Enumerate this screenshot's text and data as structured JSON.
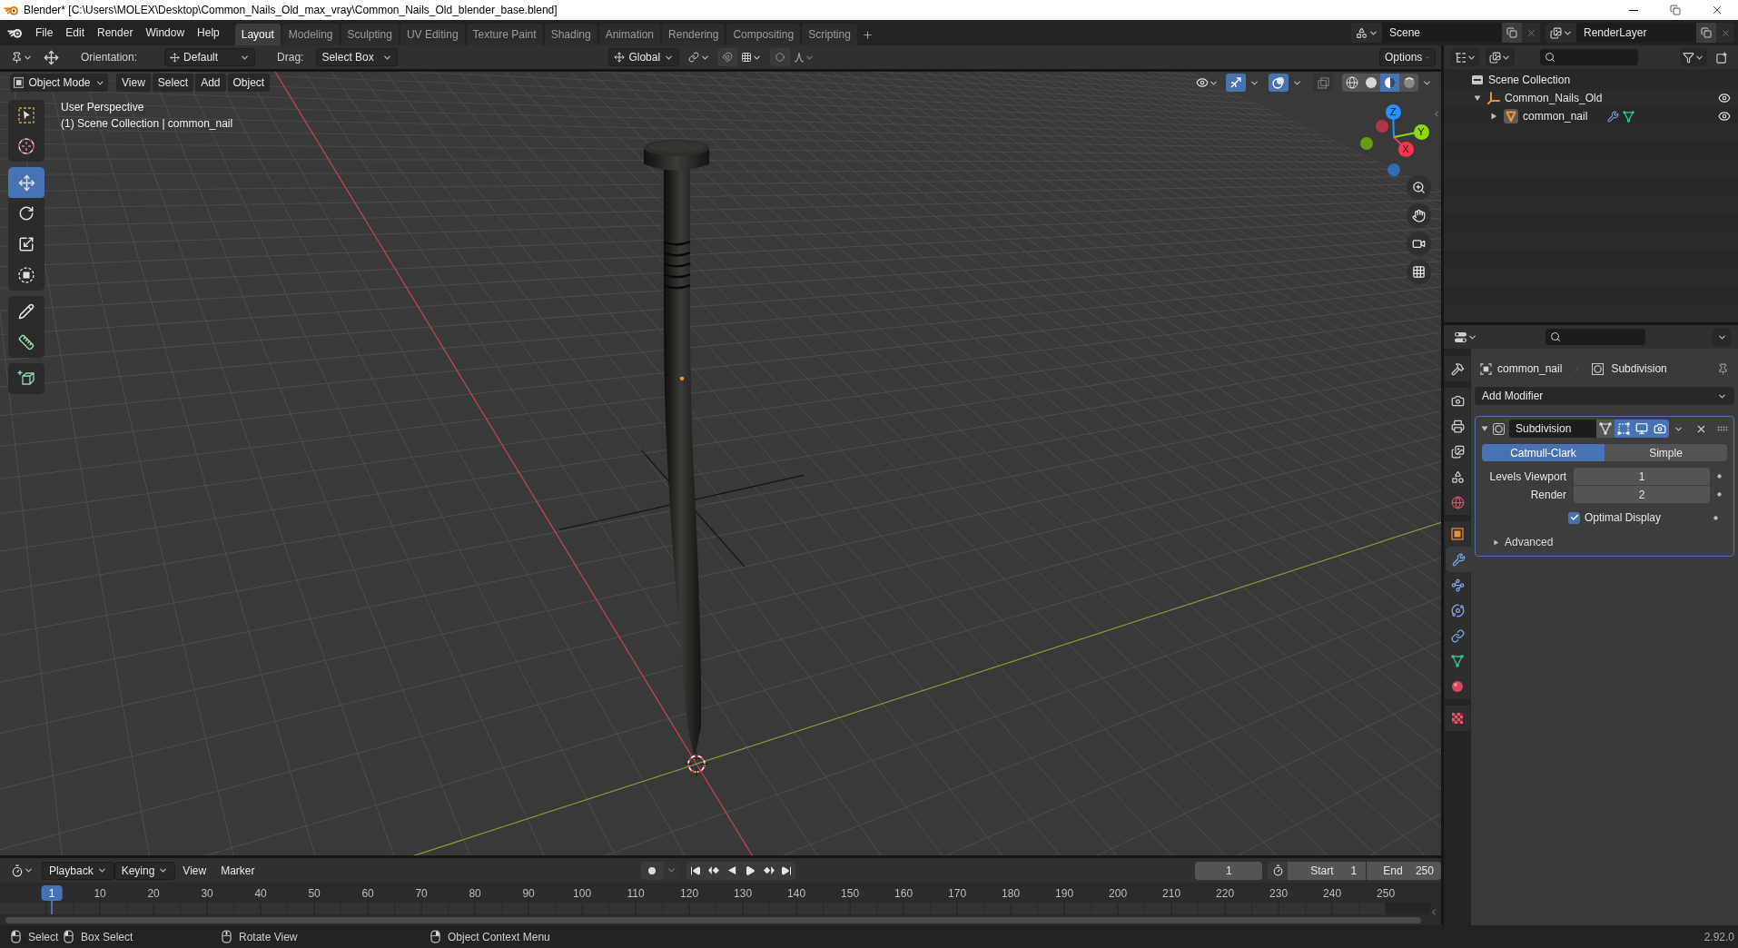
{
  "window": {
    "title": "Blender* [C:\\Users\\MOLEX\\Desktop\\Common_Nails_Old_max_vray\\Common_Nails_Old_blender_base.blend]"
  },
  "menu": [
    "File",
    "Edit",
    "Render",
    "Window",
    "Help"
  ],
  "workspaces": [
    {
      "label": "Layout",
      "selected": true
    },
    {
      "label": "Modeling",
      "selected": false
    },
    {
      "label": "Sculpting",
      "selected": false
    },
    {
      "label": "UV Editing",
      "selected": false
    },
    {
      "label": "Texture Paint",
      "selected": false
    },
    {
      "label": "Shading",
      "selected": false
    },
    {
      "label": "Animation",
      "selected": false
    },
    {
      "label": "Rendering",
      "selected": false
    },
    {
      "label": "Compositing",
      "selected": false
    },
    {
      "label": "Scripting",
      "selected": false
    }
  ],
  "scene": "Scene",
  "view_layer": "RenderLayer",
  "tool_settings": {
    "orientation_label": "Orientation:",
    "orientation": "Default",
    "drag_label": "Drag:",
    "drag": "Select Box",
    "transform_orientation": "Global",
    "options": "Options"
  },
  "viewport": {
    "mode": "Object Mode",
    "menus": [
      "View",
      "Select",
      "Add",
      "Object"
    ],
    "gizmos": true,
    "overlays": true,
    "xray": false,
    "shading": [
      {
        "selected": false
      },
      {
        "selected": false
      },
      {
        "selected": true
      },
      {
        "selected": false
      }
    ],
    "info": [
      "User Perspective",
      "(1) Scene Collection | common_nail"
    ],
    "tool_groups": [
      [
        {
          "selected": false
        },
        {
          "selected": false
        }
      ],
      [
        {
          "selected": true
        },
        {
          "selected": false
        },
        {
          "selected": false
        },
        {
          "selected": false
        }
      ],
      [
        {
          "selected": false
        },
        {
          "selected": false
        }
      ],
      [
        {
          "selected": false
        }
      ]
    ],
    "gizmo_axes": [
      {
        "label": "X",
        "color": "#ff3352"
      },
      {
        "label": "Y",
        "color": "#8bdc00"
      },
      {
        "label": "Z",
        "color": "#2890ff"
      }
    ]
  },
  "outliner": {
    "items": [
      {
        "label": "Scene Collection",
        "children": [
          {
            "label": "Common_Nails_Old",
            "expanded": true,
            "visible": true,
            "children": [
              {
                "label": "common_nail",
                "expanded": false,
                "visible": true
              }
            ]
          }
        ]
      }
    ]
  },
  "properties": {
    "tabs": [
      {
        "selected": false
      },
      {
        "selected": false
      },
      {
        "selected": false
      },
      {
        "selected": false
      },
      {
        "selected": false
      },
      {
        "selected": false
      },
      {
        "selected": false
      },
      {
        "selected": true
      },
      {
        "selected": false
      },
      {
        "selected": false
      },
      {
        "selected": false
      },
      {
        "selected": false
      },
      {
        "selected": false
      },
      {
        "selected": false
      }
    ],
    "breadcrumb": [
      "common_nail",
      "Subdivision"
    ],
    "add_modifier": "Add Modifier",
    "modifier": {
      "name": "Subdivision",
      "expanded": true,
      "toggles": [
        {
          "on": false
        },
        {
          "on": true
        },
        {
          "on": true
        },
        {
          "on": true
        }
      ],
      "methods": [
        {
          "label": "Catmull-Clark",
          "selected": true
        },
        {
          "label": "Simple",
          "selected": false
        }
      ],
      "fields": [
        {
          "label": "Levels Viewport",
          "value": "1"
        },
        {
          "label": "Render",
          "value": "2"
        }
      ],
      "optimal_display": {
        "label": "Optimal Display",
        "checked": true
      },
      "advanced": {
        "label": "Advanced",
        "expanded": false
      }
    }
  },
  "timeline": {
    "menus": [
      {
        "label": "Playback",
        "kind": "dropdown"
      },
      {
        "label": "Keying",
        "kind": "dropdown"
      },
      {
        "label": "View",
        "kind": "menu"
      },
      {
        "label": "Marker",
        "kind": "menu"
      }
    ],
    "auto_keying": false,
    "current_frame": "1",
    "start_label": "Start",
    "start": "1",
    "end_label": "End",
    "end": "250",
    "ruler": [
      {
        "label": "1",
        "selected": true
      },
      {
        "label": "10",
        "selected": false
      },
      {
        "label": "20",
        "selected": false
      },
      {
        "label": "30",
        "selected": false
      },
      {
        "label": "40",
        "selected": false
      },
      {
        "label": "50",
        "selected": false
      },
      {
        "label": "60",
        "selected": false
      },
      {
        "label": "70",
        "selected": false
      },
      {
        "label": "80",
        "selected": false
      },
      {
        "label": "90",
        "selected": false
      },
      {
        "label": "100",
        "selected": false
      },
      {
        "label": "110",
        "selected": false
      },
      {
        "label": "120",
        "selected": false
      },
      {
        "label": "130",
        "selected": false
      },
      {
        "label": "140",
        "selected": false
      },
      {
        "label": "150",
        "selected": false
      },
      {
        "label": "160",
        "selected": false
      },
      {
        "label": "170",
        "selected": false
      },
      {
        "label": "180",
        "selected": false
      },
      {
        "label": "190",
        "selected": false
      },
      {
        "label": "200",
        "selected": false
      },
      {
        "label": "210",
        "selected": false
      },
      {
        "label": "220",
        "selected": false
      },
      {
        "label": "230",
        "selected": false
      },
      {
        "label": "240",
        "selected": false
      },
      {
        "label": "250",
        "selected": false
      }
    ]
  },
  "status_bar": {
    "hints": [
      "Select",
      "Box Select",
      "Rotate View",
      "Object Context Menu"
    ],
    "version": "2.92.0"
  }
}
